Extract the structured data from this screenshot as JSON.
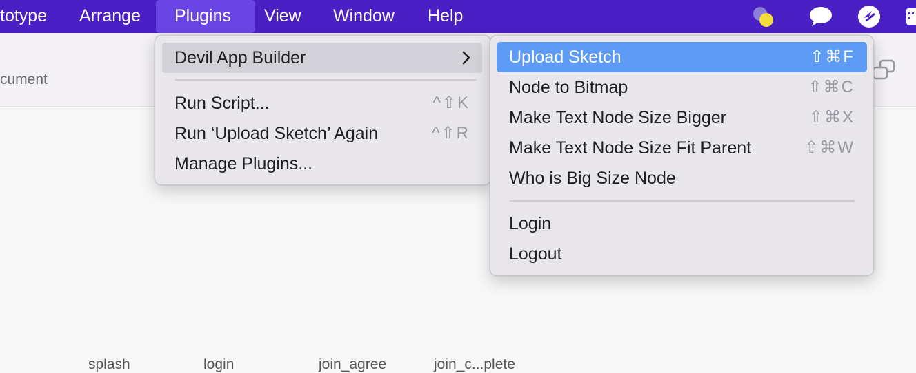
{
  "menubar": {
    "items": [
      {
        "label": "totype"
      },
      {
        "label": "Arrange"
      },
      {
        "label": "Plugins"
      },
      {
        "label": "View"
      },
      {
        "label": "Window"
      },
      {
        "label": "Help"
      }
    ],
    "colors": {
      "background": "#4a1fc4",
      "active": "#6a45e6"
    }
  },
  "toolbar": {
    "document_label": "cument"
  },
  "plugins_menu": {
    "items": [
      {
        "label": "Devil App Builder",
        "submenu": true
      },
      {
        "label": "Run Script...",
        "shortcut": "^⇧K"
      },
      {
        "label": "Run ‘Upload Sketch’ Again",
        "shortcut": "^⇧R"
      },
      {
        "label": "Manage Plugins..."
      }
    ]
  },
  "submenu": {
    "items": [
      {
        "label": "Upload Sketch",
        "shortcut": "⇧⌘F"
      },
      {
        "label": "Node to Bitmap",
        "shortcut": "⇧⌘C"
      },
      {
        "label": "Make Text Node Size Bigger",
        "shortcut": "⇧⌘X"
      },
      {
        "label": "Make Text Node Size Fit Parent",
        "shortcut": "⇧⌘W"
      },
      {
        "label": "Who is Big Size Node"
      },
      {
        "label": "Login"
      },
      {
        "label": "Logout"
      }
    ],
    "highlight_color": "#5e9bf5"
  },
  "canvas": {
    "artboards": [
      {
        "label": "splash"
      },
      {
        "label": "login"
      },
      {
        "label": "join_agree"
      },
      {
        "label": "join_c...plete"
      }
    ]
  },
  "icons": [
    "circles-icon",
    "chat-bubble-icon",
    "compass-icon",
    "calendar-icon",
    "chevron-right-icon",
    "shape-icon"
  ]
}
